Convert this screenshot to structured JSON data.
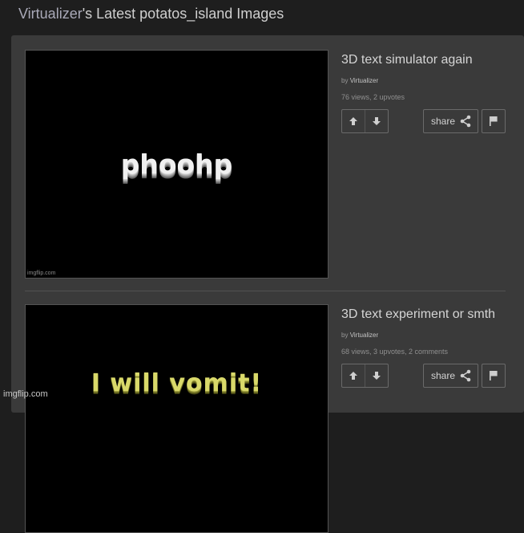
{
  "header": {
    "username": "Virtualizer",
    "suffix": "'s Latest potatos_island Images"
  },
  "posts": [
    {
      "title": "3D text simulator again",
      "by_prefix": "by",
      "author": "Virtualizer",
      "stats": "76 views, 2 upvotes",
      "image_text": "phoohp",
      "image_watermark": "imgflip.com",
      "share_label": "share"
    },
    {
      "title": "3D text experiment or smth",
      "by_prefix": "by",
      "author": "Virtualizer",
      "stats": "68 views, 3 upvotes, 2 comments",
      "image_text": "I will vomit!",
      "share_label": "share"
    }
  ],
  "site_watermark": "imgflip.com",
  "icons": {
    "upvote": "arrow-up-icon",
    "downvote": "arrow-down-icon",
    "share": "share-icon",
    "flag": "flag-icon"
  }
}
